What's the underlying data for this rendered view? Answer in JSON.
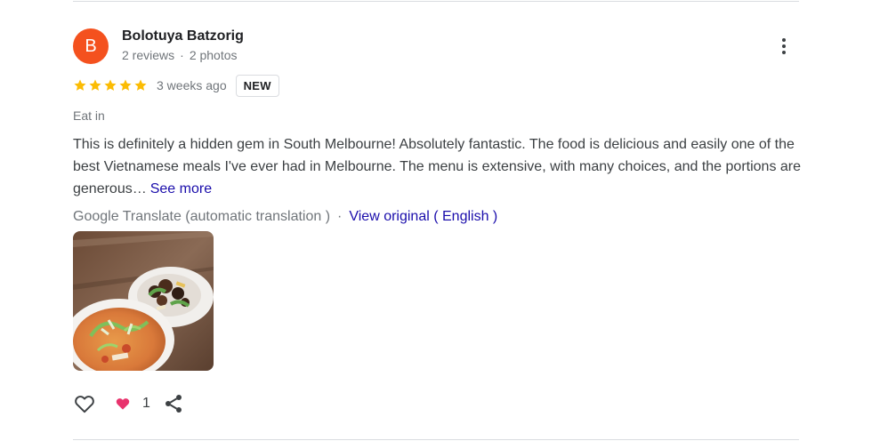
{
  "reviewer": {
    "initial": "B",
    "avatar_color": "#f4511e",
    "name": "Bolotuya Batzorig",
    "reviews": "2 reviews",
    "separator": "·",
    "photos": "2 photos"
  },
  "more_menu_icon": "more-vert-icon",
  "rating": {
    "stars": 5,
    "max_stars": 5,
    "star_color": "#fbbc04",
    "time_ago": "3 weeks ago",
    "badge": "NEW"
  },
  "dining_mode": "Eat in",
  "review": {
    "text": "This is definitely a hidden gem in South Melbourne! Absolutely fantastic. The food is delicious and easily one of the best Vietnamese meals I've ever had in Melbourne. The menu is extensive, with many choices, and the portions are generous…",
    "see_more": "See more"
  },
  "translation": {
    "label": "Google Translate (automatic translation )",
    "separator": "·",
    "view_original": "View original ( English )"
  },
  "actions": {
    "like_icon": "heart-outline-icon",
    "reaction_icon": "heart-filled-icon",
    "reaction_count": "1",
    "share_icon": "share-icon",
    "reaction_color": "#e8336d"
  },
  "link_color": "#1a0dab"
}
